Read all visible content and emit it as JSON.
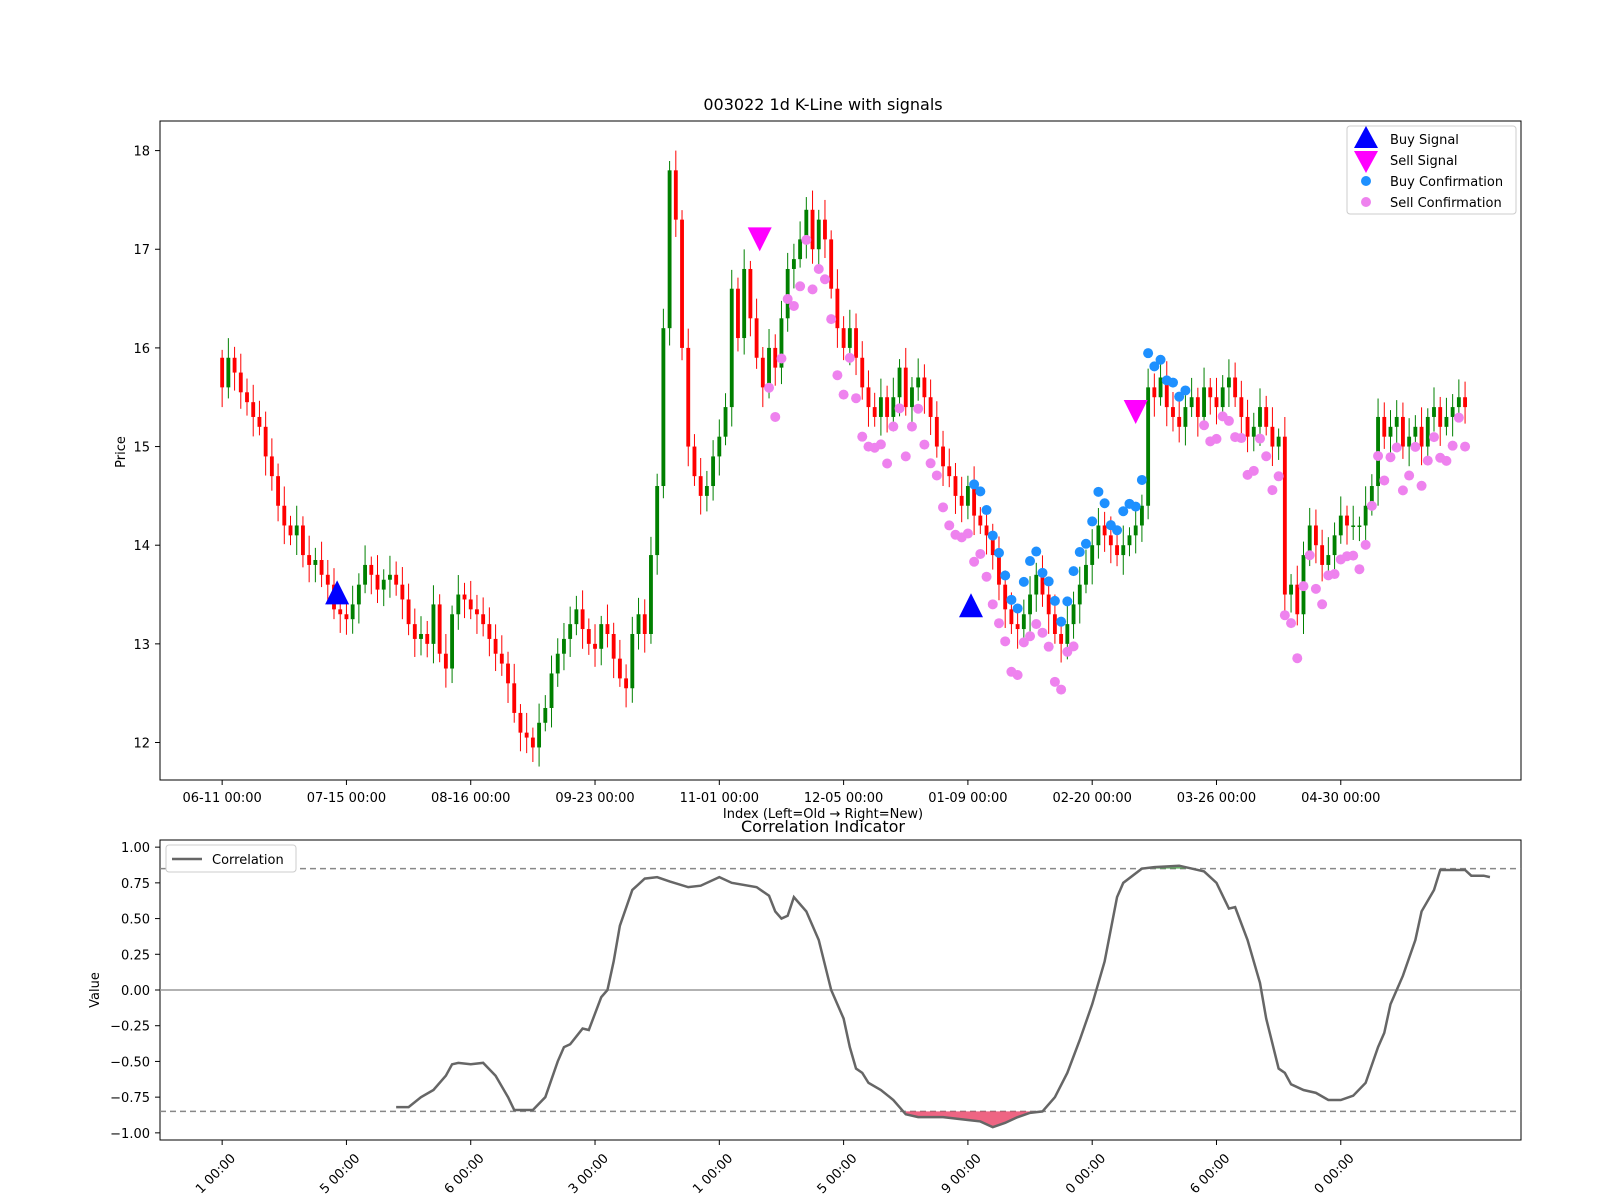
{
  "chart_data": [
    {
      "type": "candlestick",
      "title": "003022 1d K-Line with signals",
      "xlabel": "Index (Left=Old → Right=New)",
      "ylabel": "Price",
      "ylim": [
        11.62,
        18.3
      ],
      "yticks": [
        12,
        13,
        14,
        15,
        16,
        17,
        18
      ],
      "xtick_labels": [
        "06-11 00:00",
        "07-15 00:00",
        "08-16 00:00",
        "09-23 00:00",
        "11-01 00:00",
        "12-05 00:00",
        "01-09 00:00",
        "02-20 00:00",
        "03-26 00:00",
        "04-30 00:00"
      ],
      "xtick_index": [
        0,
        20,
        40,
        60,
        80,
        100,
        120,
        140,
        160,
        180
      ],
      "xlim": [
        -10,
        209
      ],
      "legend_position": "top-right",
      "legend": [
        {
          "label": "Buy Signal",
          "color": "#0000ff",
          "marker": "triangle-up"
        },
        {
          "label": "Sell Signal",
          "color": "#ff00ff",
          "marker": "triangle-down"
        },
        {
          "label": "Buy Confirmation",
          "color": "#1e90ff",
          "marker": "circle"
        },
        {
          "label": "Sell Confirmation",
          "color": "#ee82ee",
          "marker": "circle"
        }
      ],
      "colors": {
        "up": "#008000",
        "down": "#ff0000"
      },
      "close_series": [
        15.6,
        15.9,
        15.75,
        15.55,
        15.45,
        15.3,
        15.2,
        14.9,
        14.7,
        14.4,
        14.2,
        14.1,
        14.2,
        13.9,
        13.8,
        13.85,
        13.7,
        13.6,
        13.35,
        13.3,
        13.25,
        13.4,
        13.6,
        13.8,
        13.7,
        13.55,
        13.65,
        13.7,
        13.6,
        13.45,
        13.2,
        13.05,
        13.1,
        13.0,
        13.4,
        12.9,
        12.75,
        13.3,
        13.5,
        13.45,
        13.35,
        13.3,
        13.2,
        13.05,
        12.9,
        12.8,
        12.6,
        12.3,
        12.1,
        12.05,
        11.95,
        12.2,
        12.35,
        12.7,
        12.9,
        13.05,
        13.2,
        13.35,
        13.15,
        13.0,
        12.95,
        13.2,
        13.1,
        12.85,
        12.65,
        12.55,
        13.1,
        13.3,
        13.1,
        13.9,
        14.6,
        16.2,
        17.8,
        17.3,
        16.0,
        15.0,
        14.7,
        14.5,
        14.6,
        14.9,
        15.1,
        15.4,
        16.6,
        16.1,
        16.8,
        16.3,
        15.9,
        15.6,
        16.0,
        15.8,
        16.3,
        16.8,
        16.9,
        17.1,
        17.4,
        17.0,
        17.3,
        17.1,
        16.6,
        16.2,
        16.0,
        16.2,
        15.9,
        15.6,
        15.4,
        15.3,
        15.5,
        15.3,
        15.5,
        15.8,
        15.4,
        15.6,
        15.7,
        15.5,
        15.3,
        15.0,
        14.8,
        14.7,
        14.5,
        14.4,
        14.6,
        14.3,
        14.2,
        14.1,
        13.9,
        13.6,
        13.35,
        13.2,
        13.15,
        13.3,
        13.5,
        13.7,
        13.5,
        13.3,
        13.1,
        13.0,
        13.2,
        13.4,
        13.6,
        13.8,
        14.0,
        14.2,
        14.1,
        14.0,
        13.9,
        14.0,
        14.1,
        14.2,
        14.4,
        15.6,
        15.5,
        15.7,
        15.4,
        15.3,
        15.2,
        15.4,
        15.5,
        15.3,
        15.6,
        15.5,
        15.4,
        15.6,
        15.7,
        15.5,
        15.3,
        15.1,
        15.2,
        15.4,
        15.2,
        15.0,
        15.1,
        13.5,
        13.6,
        13.3,
        13.9,
        14.2,
        14.0,
        13.8,
        13.9,
        14.1,
        14.3,
        14.2,
        14.2,
        14.2,
        14.4,
        14.6,
        15.3,
        15.1,
        15.2,
        15.3,
        15.0,
        15.1,
        15.2,
        15.0,
        15.3,
        15.4,
        15.2,
        15.3,
        15.4,
        15.5,
        15.4
      ],
      "buy_signals": [
        {
          "x": "07-10 00:00",
          "y": 13.4
        },
        {
          "x": "01-10 00:00",
          "y": 13.27
        }
      ],
      "sell_signals": [
        {
          "x": "11-06 00:00",
          "y": 17.1
        },
        {
          "x": "02-28 00:00",
          "y": 15.35
        }
      ],
      "buy_confirmation_range": "01-10 00:00 to 02-28 00:00 (≈13.5–16.15)",
      "sell_confirmation_range": "11-06 00:00 to 01-10 00:00, 02-28 00:00 to 05-14 00:00"
    },
    {
      "type": "line",
      "title": "Correlation Indicator",
      "ylabel": "Value",
      "ylim": [
        -1.05,
        1.05
      ],
      "yticks": [
        1.0,
        0.75,
        0.5,
        0.25,
        0.0,
        -0.25,
        -0.5,
        -0.75,
        -1.0
      ],
      "ytick_labels": [
        "1.00",
        "0.75",
        "0.50",
        "0.25",
        "0.00",
        "−0.25",
        "−0.50",
        "−0.75",
        "−1.00"
      ],
      "xtick_labels_partial": [
        "1 00:00",
        "5 00:00",
        "6 00:00",
        "3 00:00",
        "1 00:00",
        "5 00:00",
        "9 00:00",
        "0 00:00",
        "6 00:00",
        "0 00:00"
      ],
      "thresholds": [
        0.85,
        -0.85
      ],
      "zero_line": 0.0,
      "legend_position": "top-left",
      "series": [
        {
          "name": "Correlation",
          "color": "#666666",
          "points": [
            [
              28,
              -0.82
            ],
            [
              30,
              -0.82
            ],
            [
              32,
              -0.75
            ],
            [
              34,
              -0.7
            ],
            [
              36,
              -0.6
            ],
            [
              37,
              -0.52
            ],
            [
              38,
              -0.51
            ],
            [
              40,
              -0.52
            ],
            [
              42,
              -0.51
            ],
            [
              44,
              -0.6
            ],
            [
              46,
              -0.75
            ],
            [
              47,
              -0.84
            ],
            [
              50,
              -0.84
            ],
            [
              52,
              -0.75
            ],
            [
              54,
              -0.5
            ],
            [
              55,
              -0.4
            ],
            [
              56,
              -0.38
            ],
            [
              58,
              -0.27
            ],
            [
              59,
              -0.28
            ],
            [
              61,
              -0.05
            ],
            [
              62,
              0.0
            ],
            [
              63,
              0.2
            ],
            [
              64,
              0.45
            ],
            [
              66,
              0.7
            ],
            [
              68,
              0.78
            ],
            [
              70,
              0.79
            ],
            [
              72,
              0.76
            ],
            [
              75,
              0.72
            ],
            [
              77,
              0.73
            ],
            [
              80,
              0.79
            ],
            [
              82,
              0.75
            ],
            [
              86,
              0.72
            ],
            [
              88,
              0.66
            ],
            [
              89,
              0.55
            ],
            [
              90,
              0.5
            ],
            [
              91,
              0.52
            ],
            [
              92,
              0.65
            ],
            [
              94,
              0.55
            ],
            [
              96,
              0.35
            ],
            [
              98,
              0.0
            ],
            [
              100,
              -0.2
            ],
            [
              101,
              -0.4
            ],
            [
              102,
              -0.55
            ],
            [
              103,
              -0.58
            ],
            [
              104,
              -0.65
            ],
            [
              106,
              -0.7
            ],
            [
              108,
              -0.77
            ],
            [
              110,
              -0.87
            ],
            [
              112,
              -0.89
            ],
            [
              116,
              -0.89
            ],
            [
              120,
              -0.91
            ],
            [
              122,
              -0.92
            ],
            [
              124,
              -0.96
            ],
            [
              126,
              -0.93
            ],
            [
              128,
              -0.89
            ],
            [
              130,
              -0.86
            ],
            [
              132,
              -0.85
            ],
            [
              134,
              -0.75
            ],
            [
              136,
              -0.58
            ],
            [
              138,
              -0.35
            ],
            [
              140,
              -0.1
            ],
            [
              142,
              0.2
            ],
            [
              144,
              0.65
            ],
            [
              145,
              0.75
            ],
            [
              148,
              0.85
            ],
            [
              150,
              0.86
            ],
            [
              154,
              0.87
            ],
            [
              156,
              0.85
            ],
            [
              158,
              0.83
            ],
            [
              160,
              0.75
            ],
            [
              162,
              0.57
            ],
            [
              163,
              0.58
            ],
            [
              165,
              0.35
            ],
            [
              167,
              0.05
            ],
            [
              168,
              -0.2
            ],
            [
              170,
              -0.55
            ],
            [
              171,
              -0.58
            ],
            [
              172,
              -0.66
            ],
            [
              174,
              -0.7
            ],
            [
              176,
              -0.72
            ],
            [
              178,
              -0.77
            ],
            [
              180,
              -0.77
            ],
            [
              182,
              -0.74
            ],
            [
              184,
              -0.65
            ],
            [
              186,
              -0.4
            ],
            [
              187,
              -0.3
            ],
            [
              188,
              -0.1
            ],
            [
              190,
              0.1
            ],
            [
              192,
              0.35
            ],
            [
              193,
              0.55
            ],
            [
              195,
              0.7
            ],
            [
              196,
              0.84
            ],
            [
              200,
              0.84
            ],
            [
              201,
              0.8
            ],
            [
              203,
              0.8
            ],
            [
              204,
              0.79
            ]
          ]
        }
      ]
    }
  ]
}
